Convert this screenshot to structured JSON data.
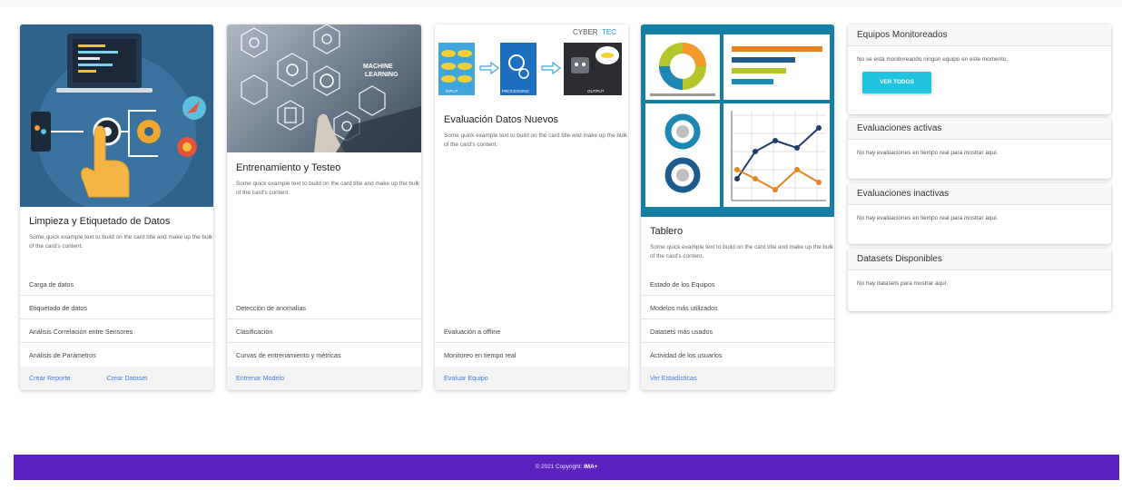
{
  "cards": [
    {
      "title": "Limpieza y Etiquetado de Datos",
      "text": "Some quick example text to build on the card title and make up the bulk of the card's content.",
      "items": [
        "Carga de datos",
        "Etiquetado de datos",
        "Análisis Correlación entre Sensores",
        "Análisis de Parámetros"
      ],
      "links": [
        "Crear Reporte",
        "Crear Dataset"
      ]
    },
    {
      "title": "Entrenamiento y Testeo",
      "text": "Some quick example text to build on the card title and make up the bulk of the card's content.",
      "items": [
        "Detección de anomalías",
        "Clasificación",
        "Curvas de entrenamiento y métricas"
      ],
      "links": [
        "Entrenar Modelo"
      ],
      "image_labels": [
        "MACHINE",
        "LEARNING"
      ]
    },
    {
      "title": "Evaluación Datos Nuevos",
      "text": "Some quick example text to build on the card title and make up the bulk of the card's content.",
      "items": [
        "Evaluación a offline",
        "Monitoreo en tiempo real"
      ],
      "links": [
        "Evaluar Equipo"
      ],
      "image_labels": {
        "brand_a": "CYBER",
        "brand_b": "TEC",
        "input": "INPUT",
        "processing": "PROCESSING",
        "output": "OUTPUT"
      }
    },
    {
      "title": "Tablero",
      "text": "Some quick example text to build on the card title and make up the bulk of the card's content.",
      "items": [
        "Estado de los Equipos",
        "Modelos más utilizados",
        "Datasets más usados",
        "Actividad de los usuarlos"
      ],
      "links": [
        "Ver Estadísticas"
      ]
    }
  ],
  "side": [
    {
      "title": "Equipos Monitoreados",
      "text": "No se está monitoreando ningún equipo en este momento.",
      "button": "VER TODOS"
    },
    {
      "title": "Evaluaciones activas",
      "text": "No hay evaluaciones en tiempo real para mostrar aquí."
    },
    {
      "title": "Evaluaciones inactivas",
      "text": "No hay evaluaciones en tiempo real para mostrar aquí."
    },
    {
      "title": "Datasets Disponibles",
      "text": "No hay datasets para mostrar aquí."
    }
  ],
  "footer": {
    "copyright": "© 2021 Copyright: ",
    "brand": "IMA+"
  },
  "colors": {
    "accent": "#21c3df",
    "footer": "#5b22c0",
    "link": "#3d7fe0"
  }
}
